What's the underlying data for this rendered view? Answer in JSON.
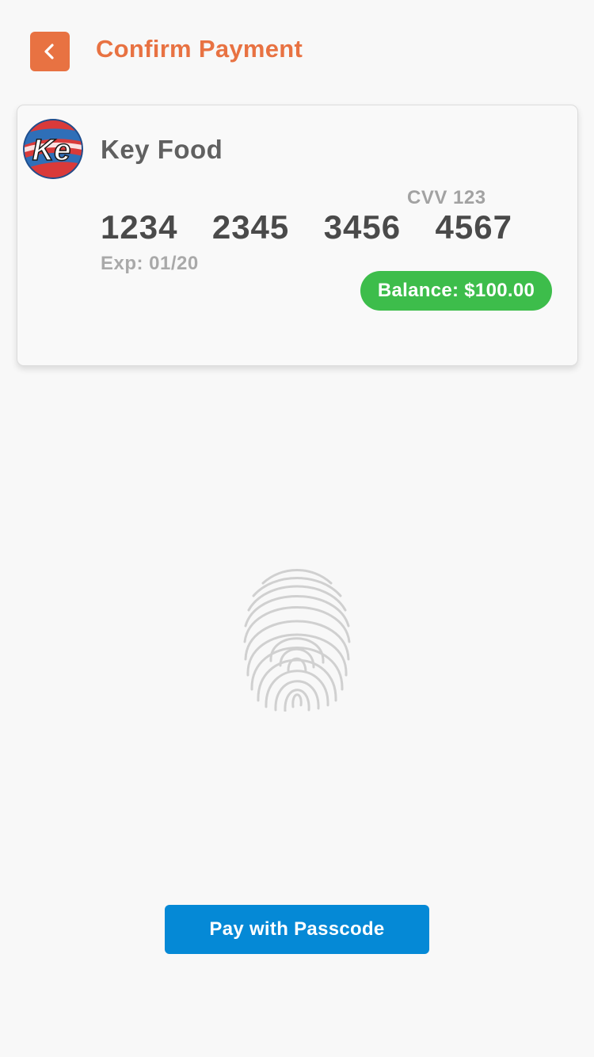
{
  "header": {
    "back_icon": "chevron-left-icon",
    "title": "Confirm Payment",
    "accent_color": "#e87242"
  },
  "card": {
    "logo_text": "Ke",
    "store_name": "Key Food",
    "cvv": "CVV 123",
    "number_groups": [
      "1234",
      "2345",
      "3456",
      "4567"
    ],
    "expiry": "Exp: 01/20",
    "balance": "Balance: $100.00",
    "balance_color": "#3dbd4b"
  },
  "auth": {
    "fingerprint_icon": "fingerprint-icon"
  },
  "footer": {
    "pay_button_label": "Pay with Passcode",
    "pay_button_color": "#0589d6"
  }
}
